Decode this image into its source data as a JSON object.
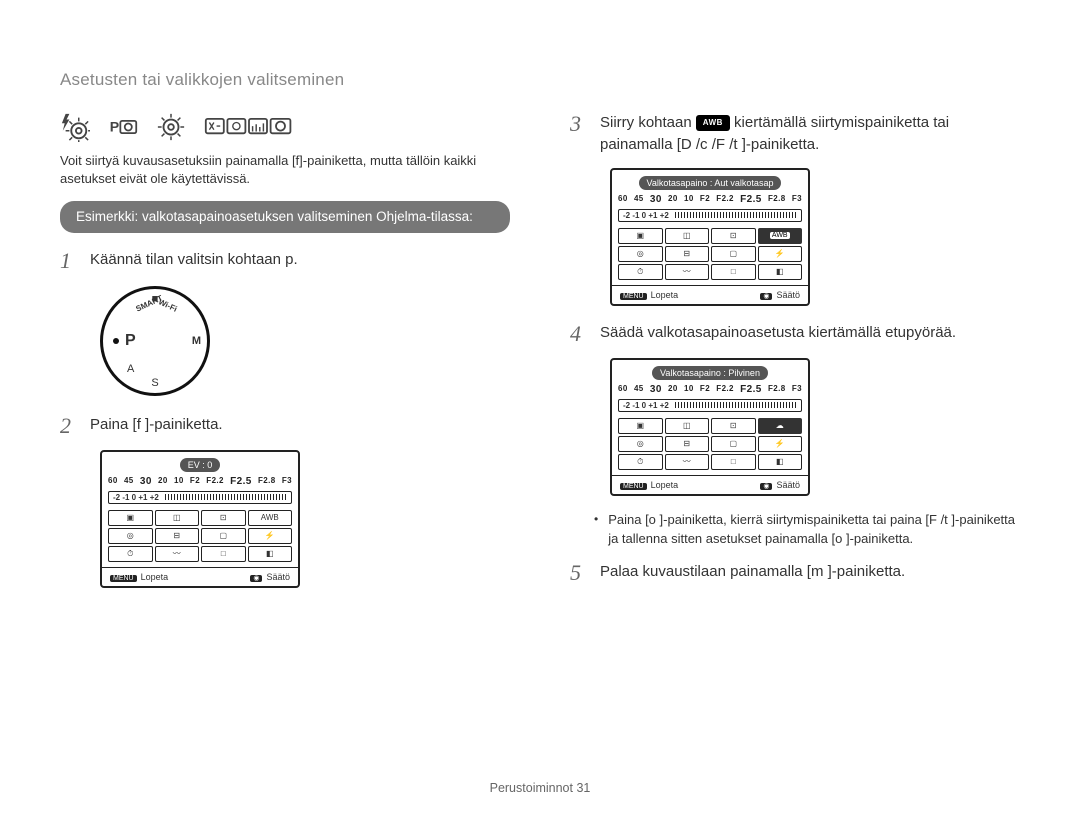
{
  "title": "Asetusten tai valikkojen valitseminen",
  "icon_row": [
    "flash-gear-icon",
    "p-cam-gear-icon",
    "gear-icon",
    "multi-cam-icons"
  ],
  "intro": "Voit siirtyä kuvausasetuksiin painamalla [f]-painiketta, mutta tällöin kaikki asetukset eivät ole käytettävissä.",
  "example_pill": "Esimerkki: valkotasapainoasetuksen valitseminen Ohjelma-tilassa:",
  "steps": {
    "s1": "Käännä tilan valitsin kohtaan p.",
    "s2": "Paina [f ]-painiketta.",
    "s3_a": "Siirry kohtaan ",
    "s3_b": " kiertämällä siirtymispainiketta tai painamalla [D   /c /F /t  ]-painiketta.",
    "s4": "Säädä valkotasapainoasetusta kiertämällä etupyörää.",
    "s5": "Palaa kuvaustilaan painamalla [m   ]-painiketta."
  },
  "bullet": "Paina [o  ]-painiketta, kierrä siirtymispainiketta tai paina [F /t  ]-painiketta ja tallenna sitten asetukset painamalla [o  ]-painiketta.",
  "dial": {
    "smart": "SMART",
    "wifi": "Wi-Fi",
    "p": "P",
    "m_s": "S",
    "m_a": "A",
    "m_m": "M"
  },
  "lcd_ev": {
    "header": "EV : 0",
    "nums": [
      "60",
      "45",
      "30",
      "20",
      "10",
      "F2",
      "F2.2",
      "F2.5",
      "F2.8",
      "F3"
    ],
    "evscale": "-2 -1 0 +1 +2",
    "footer_left_tag": "MENU",
    "footer_left": "Lopeta",
    "footer_right_tag": "◉",
    "footer_right": "Säätö"
  },
  "lcd_wb1": {
    "header": "Valkotasapaino : Aut valkotasap",
    "nums": [
      "60",
      "45",
      "30",
      "20",
      "10",
      "F2",
      "F2.2",
      "F2.5",
      "F2.8",
      "F3"
    ],
    "evscale": "-2 -1 0 +1 +2",
    "footer_left_tag": "MENU",
    "footer_left": "Lopeta",
    "footer_right_tag": "◉",
    "footer_right": "Säätö"
  },
  "lcd_wb2": {
    "header": "Valkotasapaino : Pilvinen",
    "nums": [
      "60",
      "45",
      "30",
      "20",
      "10",
      "F2",
      "F2.2",
      "F2.5",
      "F2.8",
      "F3"
    ],
    "evscale": "-2 -1 0 +1 +2",
    "footer_left_tag": "MENU",
    "footer_left": "Lopeta",
    "footer_right_tag": "◉",
    "footer_right": "Säätö"
  },
  "footer": "Perustoiminnot  31"
}
